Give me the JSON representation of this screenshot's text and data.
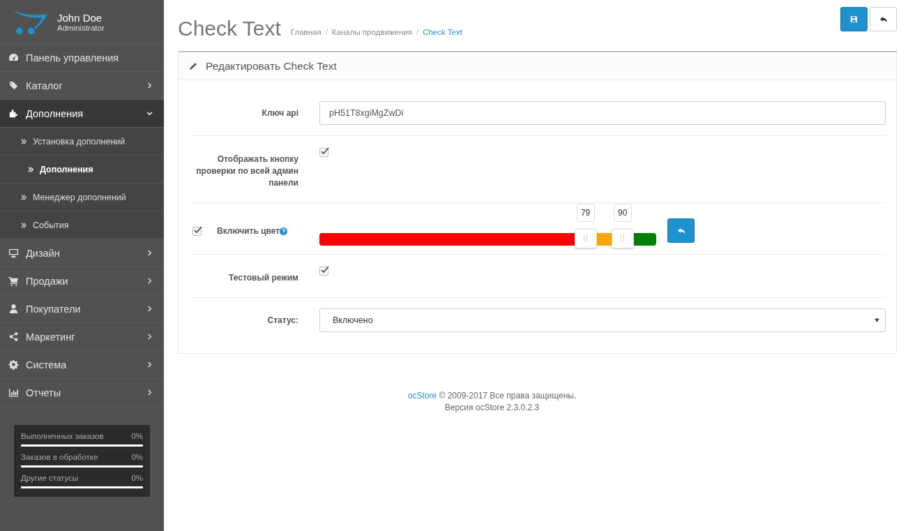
{
  "profile": {
    "name": "John Doe",
    "role": "Administrator"
  },
  "menu": [
    {
      "label": "Панель управления",
      "kind": "link",
      "expanded": false
    },
    {
      "label": "Каталог",
      "kind": "menu",
      "expanded": false
    },
    {
      "label": "Дополнения",
      "kind": "menu",
      "expanded": true,
      "children": [
        {
          "label": "Установка дополнений",
          "selected": false
        },
        {
          "label": "Дополнения",
          "selected": true
        },
        {
          "label": "Менеджер дополнений",
          "selected": false
        },
        {
          "label": "События",
          "selected": false
        }
      ]
    },
    {
      "label": "Дизайн",
      "kind": "menu",
      "expanded": false
    },
    {
      "label": "Продажи",
      "kind": "menu",
      "expanded": false
    },
    {
      "label": "Покупатели",
      "kind": "menu",
      "expanded": false
    },
    {
      "label": "Маркетинг",
      "kind": "menu",
      "expanded": false
    },
    {
      "label": "Система",
      "kind": "menu",
      "expanded": false
    },
    {
      "label": "Отчеты",
      "kind": "menu",
      "expanded": false
    }
  ],
  "stats": [
    {
      "label": "Выполненных заказов",
      "value": "0%",
      "level": 0
    },
    {
      "label": "Заказов в обработке",
      "value": "0%",
      "level": 0
    },
    {
      "label": "Другие статусы",
      "value": "0%",
      "level": 0
    }
  ],
  "page": {
    "title": "Check Text",
    "separator": "/",
    "breadcrumbs": [
      {
        "label": "Главная",
        "current": false
      },
      {
        "label": "Каналы продвижения",
        "current": false
      },
      {
        "label": "Check Text",
        "current": true
      }
    ]
  },
  "panel": {
    "title": "Редактировать Check Text",
    "rows": [
      {
        "kind": "text",
        "label": "Ключ api",
        "value": "pH51T8xgiMgZwDi"
      },
      {
        "kind": "checkbox",
        "label": "Отображать кнопку проверки по всей админ панели",
        "checked": true
      },
      {
        "kind": "range",
        "label": "Включить цвет",
        "checked": true,
        "low": {
          "reading": "79",
          "level": 0.79
        },
        "high": {
          "reading": "90",
          "level": 0.9
        }
      },
      {
        "kind": "checkbox",
        "label": "Тестовый режим",
        "checked": true
      },
      {
        "kind": "select",
        "label": "Статус:",
        "value": "Включено"
      }
    ]
  },
  "footer": {
    "brand": "ocStore",
    "copyright": "© 2009-2017 Все права защищены.",
    "version": "Версия ocStore 2.3.0.2.3"
  }
}
